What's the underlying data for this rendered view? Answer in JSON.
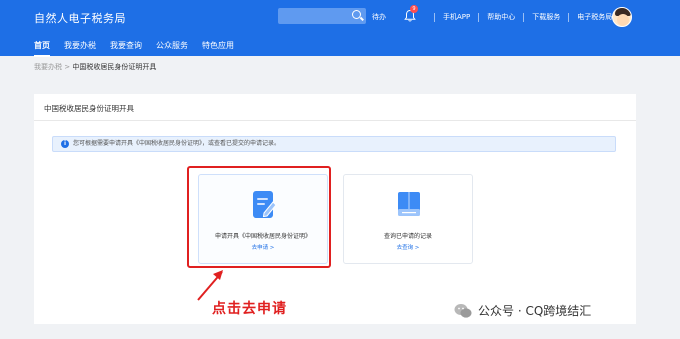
{
  "header": {
    "brand": "自然人电子税务局",
    "search_placeholder": "",
    "todo_label": "待办",
    "badge_count": "9",
    "links": [
      "手机APP",
      "帮助中心",
      "下载服务",
      "电子税务局"
    ]
  },
  "nav": {
    "items": [
      {
        "label": "首页",
        "active": true
      },
      {
        "label": "我要办税",
        "active": false
      },
      {
        "label": "我要查询",
        "active": false
      },
      {
        "label": "公众服务",
        "active": false
      },
      {
        "label": "特色应用",
        "active": false
      }
    ]
  },
  "breadcrumb": {
    "parent": "我要办税",
    "separator": ">",
    "current": "中国税收居民身份证明开具"
  },
  "panel": {
    "title": "中国税收居民身份证明开具",
    "notice": "您可根据需要申请开具《中国税收居民身份证明》，或查看已提交的申请记录。",
    "cards": [
      {
        "label": "申请开具《中国税收居民身份证明》",
        "link": "去申请 >",
        "icon": "document-edit-icon"
      },
      {
        "label": "查询已申请的记录",
        "link": "去查询 >",
        "icon": "book-icon"
      }
    ]
  },
  "annotation": {
    "callout": "点击去申请",
    "color": "#e02020"
  },
  "watermark": {
    "text": "公众号 · CQ跨境结汇"
  },
  "colors": {
    "primary": "#1e6fe6",
    "background": "#f0f2f5"
  }
}
